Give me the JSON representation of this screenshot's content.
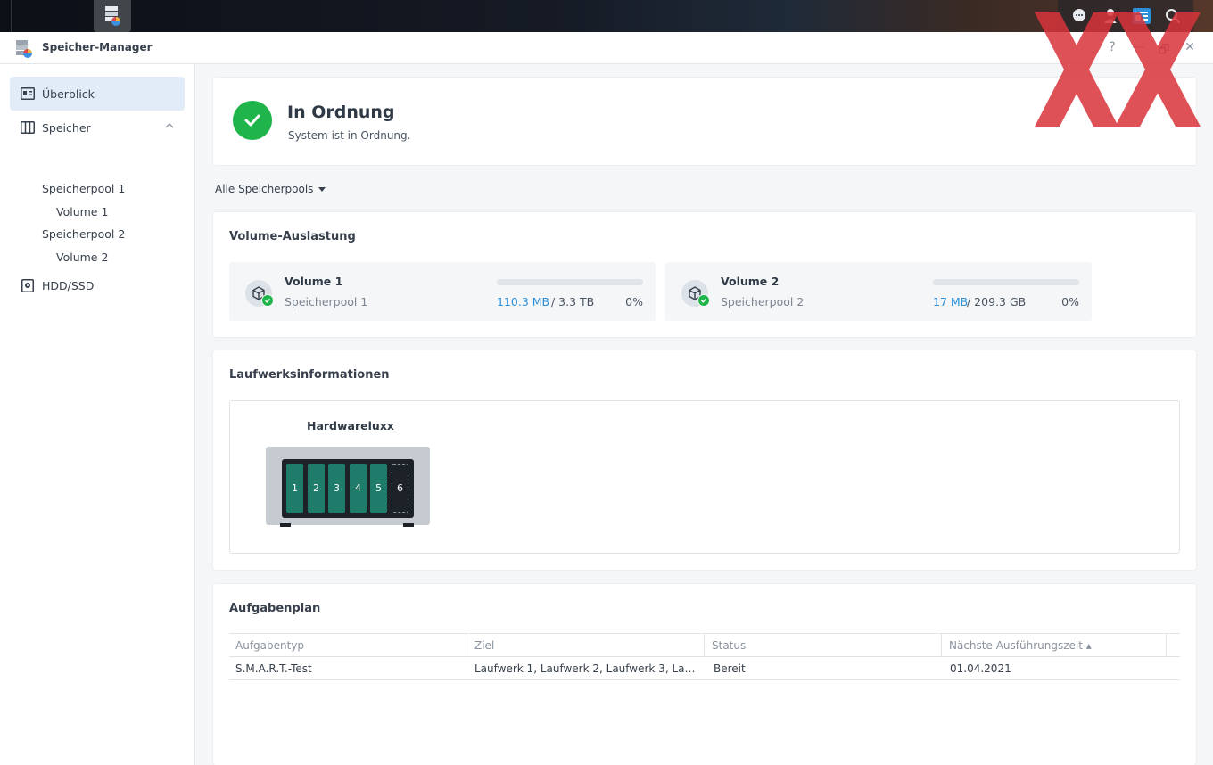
{
  "app": {
    "title": "Speicher-Manager",
    "window_controls": [
      "?",
      "—",
      "🗗",
      "✕"
    ]
  },
  "sidebar": {
    "items": [
      {
        "label": "Überblick",
        "icon": "overview-icon",
        "selected": true
      },
      {
        "label": "Speicher",
        "icon": "storage-icon",
        "expanded": true
      },
      {
        "label": "HDD/SSD",
        "icon": "hdd-icon"
      }
    ],
    "sub_items": [
      {
        "label": "Speicherpool 1"
      },
      {
        "label": "Volume 1"
      },
      {
        "label": "Speicherpool 2"
      },
      {
        "label": "Volume 2"
      }
    ]
  },
  "status": {
    "title": "In Ordnung",
    "subtitle": "System ist in Ordnung.",
    "color": "#1fb54a"
  },
  "filter": {
    "label": "Alle Speicherpools"
  },
  "volume_usage": {
    "title": "Volume-Auslastung",
    "volumes": [
      {
        "name": "Volume 1",
        "pool": "Speicherpool 1",
        "used": "110.3 MB",
        "total": "/ 3.3 TB",
        "percent": "0%",
        "fill_fraction": 0.0
      },
      {
        "name": "Volume 2",
        "pool": "Speicherpool 2",
        "used": "17 MB",
        "total": "/ 209.3 GB",
        "percent": "0%",
        "fill_fraction": 0.0
      }
    ]
  },
  "drive_info": {
    "title": "Laufwerksinformationen",
    "nas_name": "Hardwareluxx",
    "bays": [
      "1",
      "2",
      "3",
      "4",
      "5",
      "6"
    ],
    "bay_occupied": [
      true,
      true,
      true,
      true,
      true,
      false
    ]
  },
  "schedule": {
    "title": "Aufgabenplan",
    "columns": [
      "Aufgabentyp",
      "Ziel",
      "Status",
      "Nächste Ausführungszeit ▴"
    ],
    "rows": [
      [
        "S.M.A.R.T.-Test",
        "Laufwerk 1, Laufwerk 2, Laufwerk 3, La…",
        "Bereit",
        "01.04.2021"
      ]
    ]
  },
  "colors": {
    "accent": "#2d8fd8",
    "ok": "#1fb54a",
    "bay": "#1f7c6b",
    "watermark": "#d9343a"
  }
}
